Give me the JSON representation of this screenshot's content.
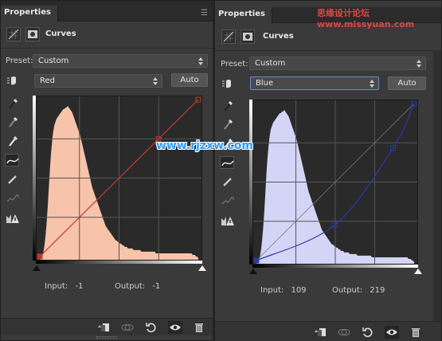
{
  "watermarks": {
    "top_right": "思缘设计论坛 www.missyuan.com",
    "center": "www.rjzxw.com"
  },
  "panels": [
    {
      "id": "left",
      "tab_title": "Properties",
      "panel_title": "Curves",
      "preset_label": "Preset:",
      "preset_value": "Custom",
      "channel_value": "Red",
      "auto_label": "Auto",
      "input_label": "Input:",
      "input_value": "-1",
      "output_label": "Output:",
      "output_value": "-1",
      "curve_color": "#c0392b",
      "histogram_color": "#f7c3aa",
      "curve_points": [
        [
          0,
          0
        ],
        [
          191,
          191
        ],
        [
          255,
          255
        ]
      ],
      "selected_point": [
        0,
        0
      ]
    },
    {
      "id": "right",
      "tab_title": "Properties",
      "panel_title": "Curves",
      "preset_label": "Preset:",
      "preset_value": "Custom",
      "channel_value": "Blue",
      "auto_label": "Auto",
      "input_label": "Input:",
      "input_value": "109",
      "output_label": "Output:",
      "output_value": "219",
      "curve_color": "#2a3aa8",
      "histogram_color": "#d4d4f6",
      "curve_points": [
        [
          0,
          0
        ],
        [
          127,
          58
        ],
        [
          221,
          183
        ],
        [
          255,
          255
        ]
      ],
      "selected_point": [
        0,
        0
      ]
    }
  ],
  "histogram": [
    0,
    1,
    2,
    4,
    8,
    14,
    22,
    32,
    44,
    56,
    66,
    74,
    80,
    84,
    86,
    88,
    89,
    90,
    91,
    92,
    93,
    94,
    94,
    95,
    95,
    96,
    95,
    94,
    93,
    92,
    90,
    88,
    86,
    84,
    82,
    80,
    78,
    75,
    72,
    69,
    66,
    63,
    60,
    57,
    54,
    51,
    48,
    45,
    43,
    41,
    39,
    37,
    35,
    33,
    31,
    29,
    27,
    25,
    23,
    21,
    20,
    19,
    18,
    17,
    16,
    15,
    14,
    13,
    12,
    12,
    11,
    11,
    10,
    10,
    9,
    9,
    8,
    8,
    8,
    7,
    7,
    7,
    7,
    7,
    6,
    6,
    6,
    6,
    6,
    6,
    6,
    5,
    5,
    5,
    5,
    5,
    5,
    5,
    5,
    5,
    5,
    5,
    5,
    5,
    4,
    4,
    4,
    4,
    4,
    4,
    4,
    4,
    4,
    4,
    4,
    4,
    4,
    4,
    4,
    4,
    4,
    4,
    4,
    4,
    4,
    4,
    4,
    4,
    4,
    4,
    4,
    4,
    4,
    4,
    4,
    4,
    4,
    3,
    3,
    3,
    2,
    2,
    1
  ]
}
